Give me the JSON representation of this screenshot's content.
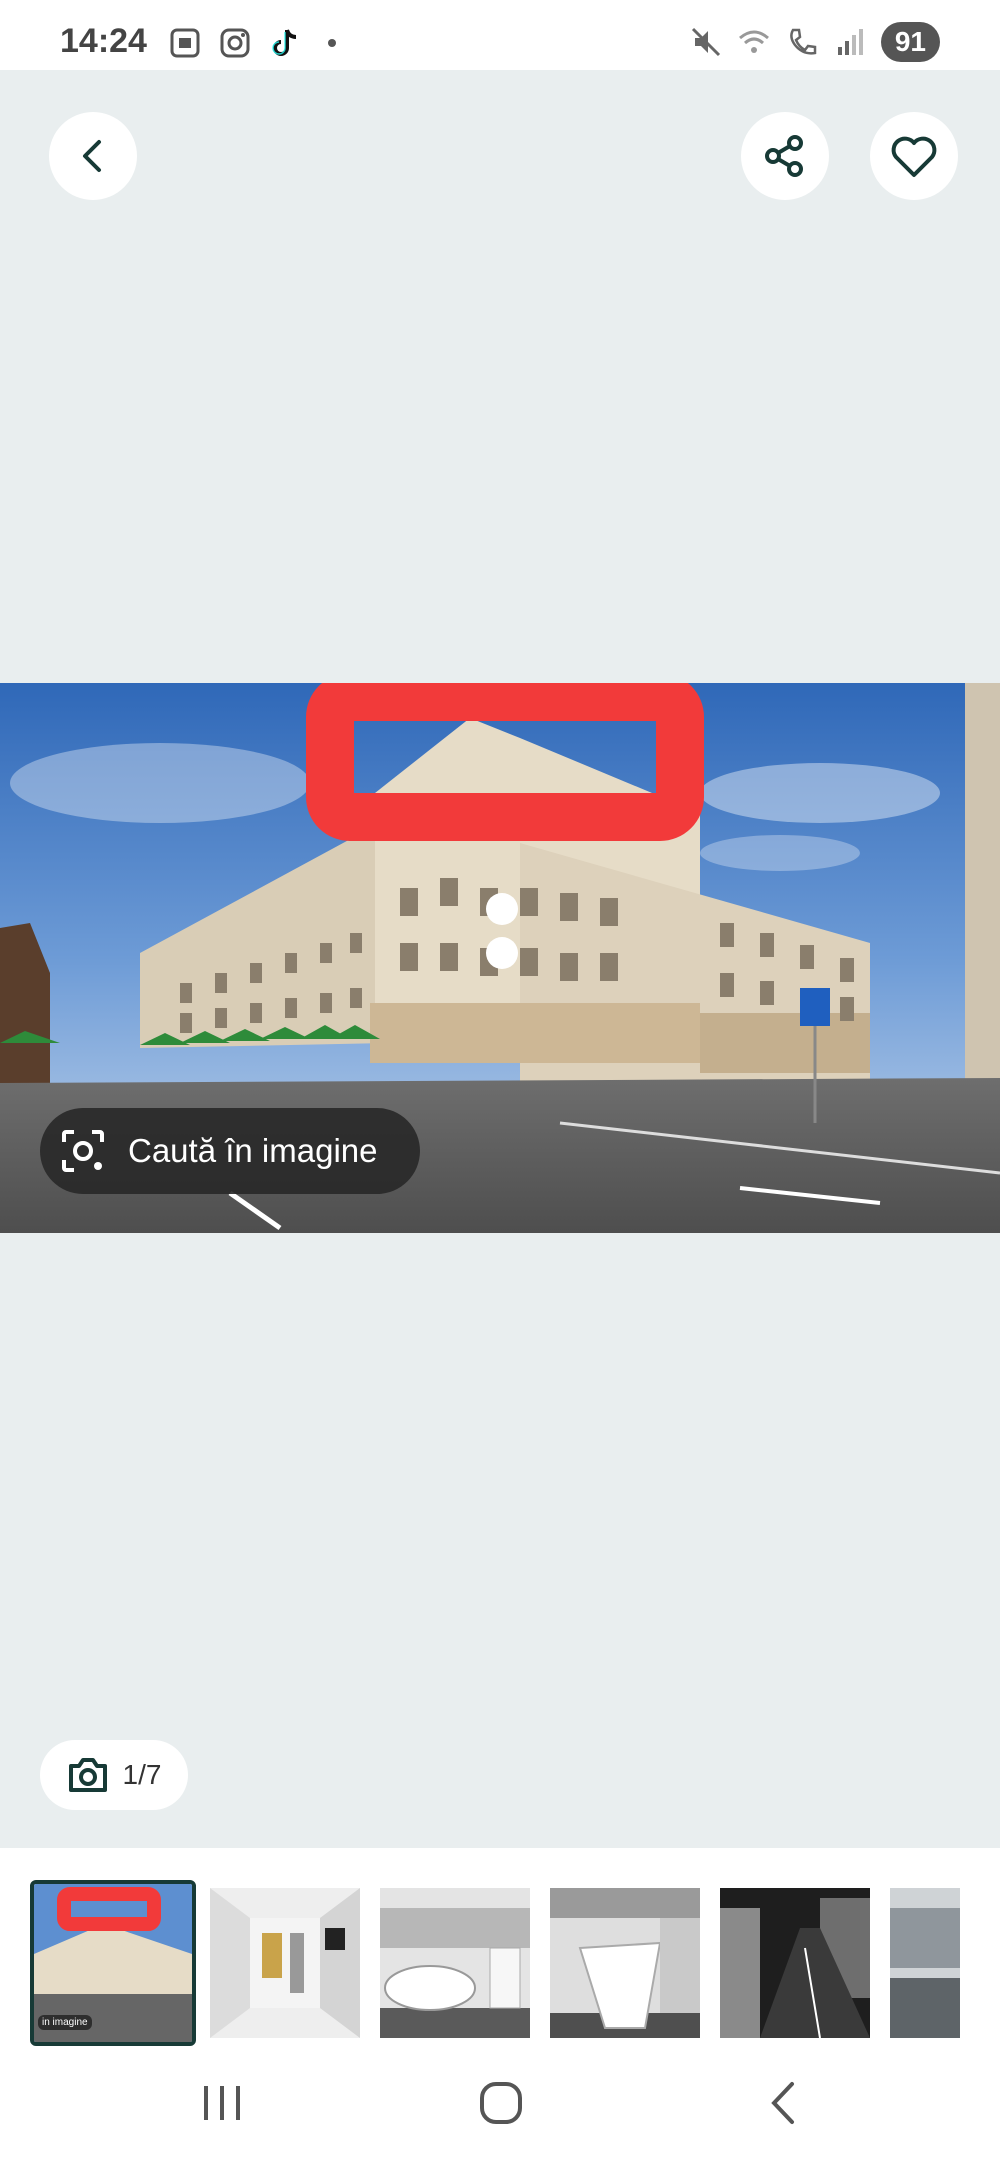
{
  "status_bar": {
    "time": "14:24",
    "left_icons": [
      "screenshot-icon",
      "instagram-icon",
      "tiktok-icon"
    ],
    "right_icons": [
      "mute-icon",
      "wifi-icon",
      "call-icon",
      "signal-icon"
    ],
    "battery": "91"
  },
  "top_actions": {
    "back": "back-icon",
    "share": "share-icon",
    "favorite": "heart-icon"
  },
  "photo": {
    "lens_button_label": "Caută în imagine"
  },
  "counter": {
    "text": "1/7"
  },
  "thumbnails": [
    {
      "label": "in imagine",
      "active": true
    },
    {
      "label": ""
    },
    {
      "label": ""
    },
    {
      "label": ""
    },
    {
      "label": ""
    },
    {
      "label": ""
    }
  ],
  "colors": {
    "accent": "#173a36",
    "background": "#e9eeef",
    "highlight": "#f23a3a"
  }
}
